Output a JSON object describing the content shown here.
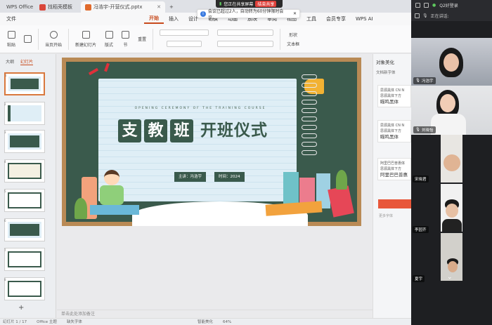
{
  "titlebar": {
    "app_tab": "WPS Office",
    "tabs": [
      {
        "label": "找稻壳模板",
        "icon_color": "#d9463a"
      },
      {
        "label": "冯浩宇-开营仪式.pptx",
        "icon_color": "#e06a2c"
      }
    ],
    "add_tab": "+",
    "share_banner": "您正在共享屏幕",
    "stop_share": "结束共享"
  },
  "notice": "会议已超过2人，自动转为60分钟限时会议。",
  "menubar": {
    "items": [
      "文件",
      "开始",
      "插入",
      "设计",
      "切换",
      "动画",
      "放映",
      "审阅",
      "视图",
      "工具",
      "会员专享",
      "WPS AI"
    ],
    "active": "开始"
  },
  "ribbon": {
    "paste": "粘贴",
    "play": "当页开始",
    "new_slide": "新建幻灯片",
    "layout": "版式",
    "section": "节",
    "reset": "重置",
    "shape": "形状",
    "textbox": "文本框"
  },
  "left_panel": {
    "tab_outline": "大纲",
    "tab_slides": "幻灯片",
    "slides": [
      "1",
      "2",
      "3",
      "4",
      "5",
      "6",
      "7",
      "8"
    ],
    "add": "+"
  },
  "slide": {
    "subtitle_en": "OPENING CEREMONY OF THE TRAINING COURSE",
    "title_boxed": [
      "支",
      "教",
      "班"
    ],
    "title_plain": "开班仪式",
    "speaker": "主讲：冯浩宇",
    "time": "时间：2024"
  },
  "notes": "单击此处添加备注",
  "status": {
    "page": "幻灯片 1 / 17",
    "theme": "Office 主题",
    "font": "缺失字体",
    "smart": "智能美化",
    "zoom": "64%"
  },
  "right_panel": {
    "title": "对象美化",
    "section": "文档新字体",
    "cards": [
      {
        "line1": "思源黑体 CN N",
        "line2": "思源黑体下方",
        "big": "瞄鸣黑体"
      },
      {
        "line1": "思源黑体 CN N",
        "line2": "思源黑体下方",
        "big": "瞄鸣黑体"
      },
      {
        "line1": "阿里巴巴普惠体",
        "line2": "思源黑体下方",
        "big": "阿里巴巴普惠"
      }
    ],
    "more": "更多字体"
  },
  "meeting": {
    "title": "Q2好登录",
    "status": "正在讲话:",
    "participants": [
      {
        "name": "冯浩宇"
      },
      {
        "name": "刘晓怡"
      },
      {
        "name": "宋晓君"
      },
      {
        "name": "李园齐"
      },
      {
        "name": "夏宇"
      }
    ],
    "scroll": "⌄"
  }
}
